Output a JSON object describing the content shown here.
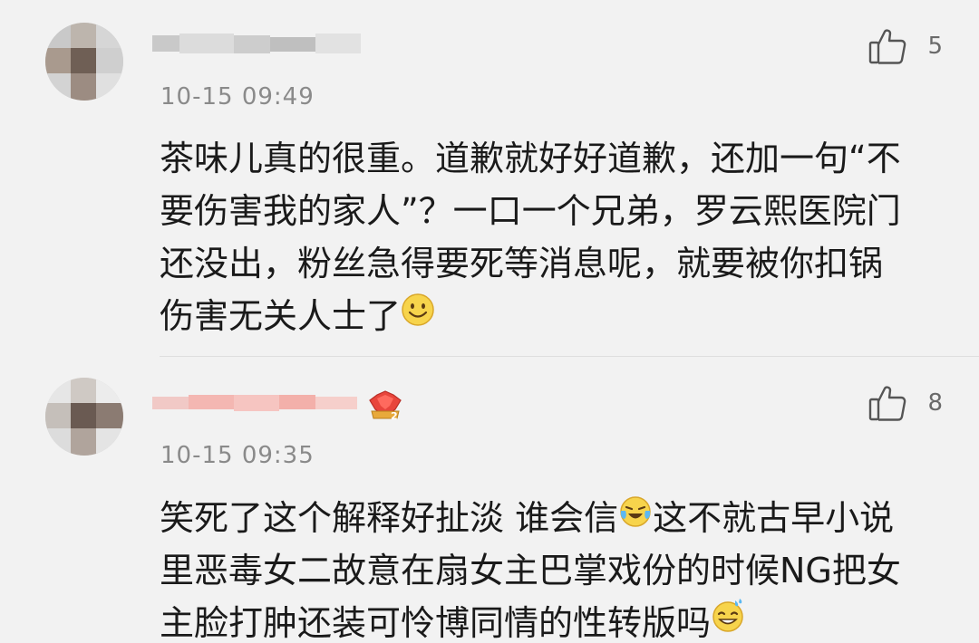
{
  "comments": [
    {
      "timestamp": "10-15 09:49",
      "like_count": "5",
      "lines": [
        "茶味儿真的很重。道歉就好好道歉，还加一句“不",
        "要伤害我的家人”？一口一个兄弟，罗云熙医院门",
        "还没出，粉丝急得要死等消息呢，就要被你扣锅",
        "伤害无关人士了"
      ]
    },
    {
      "timestamp": "10-15 09:35",
      "like_count": "8",
      "lines": [
        "笑死了这个解释好扯淡 谁会信",
        "这不就古早小说",
        "里恶毒女二故意在扇女主巴掌戏份的时候NG把女",
        "主脸打肿还装可怜博同情的性转版吗"
      ]
    }
  ],
  "icons": {
    "like": "thumbs-up-icon",
    "smile": "smile-emoji-icon",
    "crying_laugh": "laugh-cry-emoji-icon",
    "sweat_smile": "sweat-smile-emoji-icon",
    "member_badge": "crown-badge-icon"
  },
  "colors": {
    "background": "#f2f2f2",
    "text": "#1a1a1a",
    "meta": "#8a8a8a",
    "badge_gold": "#e8a93a",
    "badge_red": "#e8453c"
  }
}
